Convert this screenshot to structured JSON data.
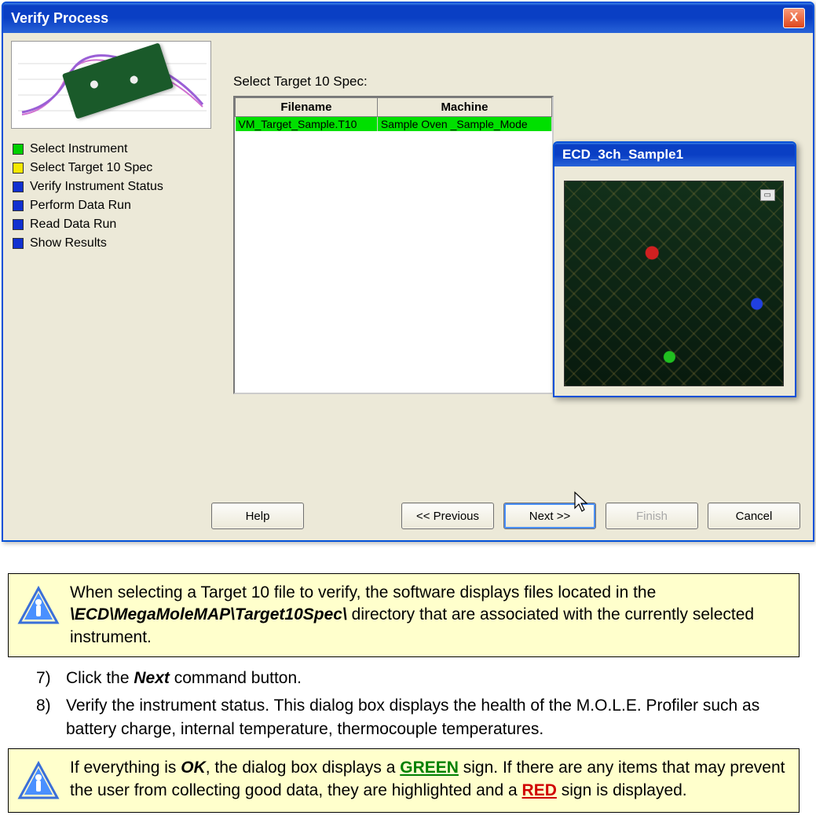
{
  "window": {
    "title": "Verify Process",
    "close_label": "X"
  },
  "sidebar": {
    "steps": [
      {
        "label": "Select Instrument",
        "color": "green"
      },
      {
        "label": "Select Target 10 Spec",
        "color": "yellow"
      },
      {
        "label": "Verify Instrument Status",
        "color": "blue"
      },
      {
        "label": "Perform Data Run",
        "color": "blue"
      },
      {
        "label": "Read Data Run",
        "color": "blue"
      },
      {
        "label": "Show Results",
        "color": "blue"
      }
    ]
  },
  "main": {
    "label": "Select Target 10 Spec:",
    "columns": [
      "Filename",
      "Machine"
    ],
    "rows": [
      {
        "filename": "VM_Target_Sample.T10",
        "machine": "Sample Oven _Sample_Mode",
        "selected": true
      }
    ]
  },
  "overlay": {
    "title": "ECD_3ch_Sample1"
  },
  "buttons": {
    "help": "Help",
    "previous": "<< Previous",
    "next": "Next >>",
    "finish": "Finish",
    "cancel": "Cancel"
  },
  "notes": {
    "note1_a": "When selecting a Target 10 file to verify, the software displays files located in the ",
    "note1_b": "\\ECD\\MegaMoleMAP\\Target10Spec\\",
    "note1_c": " directory that are associated with the currently selected instrument.",
    "note2_a": "If everything is ",
    "note2_ok": "OK",
    "note2_b": ", the dialog box displays a ",
    "note2_green": "GREEN",
    "note2_c": " sign. If there are any items that may prevent the user from collecting good data, they are highlighted and a ",
    "note2_red": "RED",
    "note2_d": " sign is displayed."
  },
  "steps_text": {
    "s7_num": "7)",
    "s7_a": "Click the ",
    "s7_next": "Next",
    "s7_b": " command button.",
    "s8_num": "8)",
    "s8": "Verify the instrument status. This dialog box displays the health of the M.O.L.E. Profiler such as battery charge, internal temperature, thermocouple temperatures."
  }
}
